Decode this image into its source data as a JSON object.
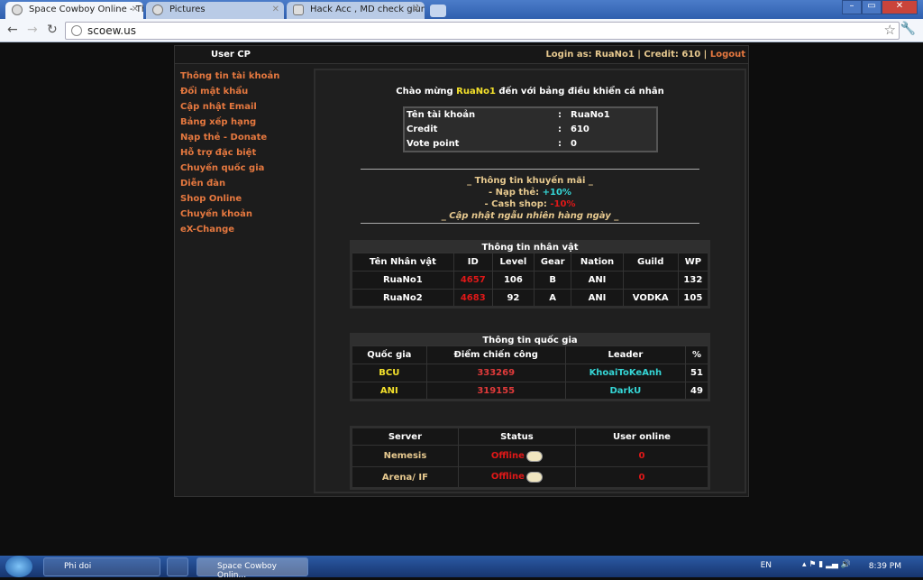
{
  "browser": {
    "tabs": [
      {
        "title": "Space Cowboy Online - The",
        "active": true
      },
      {
        "title": "Pictures ",
        "active": false
      },
      {
        "title": "Hack Acc , MD check giùm",
        "active": false
      }
    ],
    "url": "scoew.us"
  },
  "header": {
    "title": "User CP",
    "login_prefix": "Login as: RuaNo1 | Credit: 610 | ",
    "logout": "Logout"
  },
  "sidebar": {
    "items": [
      "Thông tin tài khoản",
      "Đổi mật khẩu",
      "Cập nhật Email",
      "Bảng xếp hạng",
      "Nạp thẻ - Donate",
      "Hỗ trợ đặc biệt",
      "Chuyển quốc gia",
      "Diễn đàn",
      "Shop Online",
      "Chuyển khoản",
      "eX-Change"
    ]
  },
  "welcome": {
    "pre": "Chào mừng ",
    "user": "RuaNo1",
    "post": " đến với bảng điều khiển cá nhân"
  },
  "account": [
    {
      "label": "Tên tài khoản",
      "value": "RuaNo1"
    },
    {
      "label": "Credit",
      "value": "610"
    },
    {
      "label": "Vote point",
      "value": "0"
    }
  ],
  "promo": {
    "title": "_ Thông tin khuyến mãi _",
    "nap_label": "- Nạp thẻ: ",
    "nap_value": "+10%",
    "cash_label": "- Cash shop: ",
    "cash_value": "-10%",
    "note": "_ Cập nhật ngẫu nhiên hàng ngày _"
  },
  "characters": {
    "caption": "Thông tin nhân vật",
    "headers": [
      "Tên Nhân vật",
      "ID",
      "Level",
      "Gear",
      "Nation",
      "Guild",
      "WP"
    ],
    "rows": [
      [
        "RuaNo1",
        "4657",
        "106",
        "B",
        "ANI",
        "",
        "132"
      ],
      [
        "RuaNo2",
        "4683",
        "92",
        "A",
        "ANI",
        "VODKA",
        "105"
      ]
    ]
  },
  "nations": {
    "caption": "Thông tin quốc gia",
    "headers": [
      "Quốc gia",
      "Điểm chiến công",
      "Leader",
      "%"
    ],
    "rows": [
      [
        "BCU",
        "333269",
        "KhoaiToKeAnh",
        "51"
      ],
      [
        "ANI",
        "319155",
        "DarkU",
        "49"
      ]
    ]
  },
  "servers": {
    "headers": [
      "Server",
      "Status",
      "User online"
    ],
    "rows": [
      [
        "Nemesis",
        "Offline",
        "0"
      ],
      [
        "Arena/ IF",
        "Offline",
        "0"
      ]
    ]
  },
  "taskbar": {
    "items": [
      "Phi doi",
      "Space Cowboy Onlin..."
    ],
    "lang": "EN",
    "time": "8:39 PM"
  }
}
